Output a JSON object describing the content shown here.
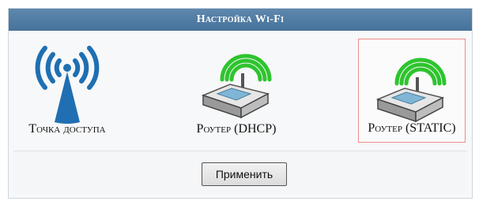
{
  "window": {
    "title": "Настройка Wi-Fi"
  },
  "modes": [
    {
      "label": "Точка доступа",
      "icon": "wifi-access-point-icon",
      "selected": false
    },
    {
      "label": "Роутер (DHCP)",
      "icon": "router-icon",
      "selected": false
    },
    {
      "label": "Роутер (STATIC)",
      "icon": "router-icon",
      "selected": true
    }
  ],
  "actions": {
    "apply_label": "Применить"
  },
  "colors": {
    "titlebar": "#4f7ca3",
    "selection_border": "#f08a8a",
    "wifi_blue": "#1f6fb2",
    "signal_green": "#2ec42e"
  }
}
